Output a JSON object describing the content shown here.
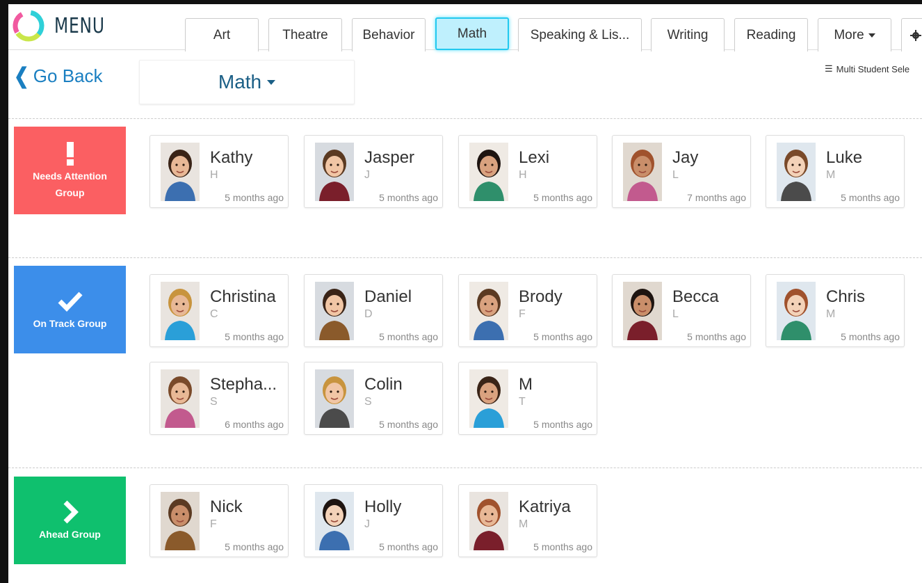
{
  "brand": {
    "menu_label": "MENU"
  },
  "tabs": [
    {
      "label": "Art",
      "active": false
    },
    {
      "label": "Theatre",
      "active": false
    },
    {
      "label": "Behavior",
      "active": false
    },
    {
      "label": "Math",
      "active": true
    },
    {
      "label": "Speaking & Lis...",
      "active": false
    },
    {
      "label": "Writing",
      "active": false
    },
    {
      "label": "Reading",
      "active": false
    },
    {
      "label": "More",
      "active": false
    }
  ],
  "go_back_label": "Go Back",
  "subject_dropdown": {
    "value": "Math"
  },
  "multi_select_label": "Multi Student Sele",
  "groups": [
    {
      "label_line1": "Needs Attention",
      "label_line2": "Group",
      "color": "#fb5f62",
      "icon": "exclamation-icon",
      "students": [
        {
          "name": "Kathy",
          "initial": "H",
          "updated": "5 months ago"
        },
        {
          "name": "Jasper",
          "initial": "J",
          "updated": "5 months ago"
        },
        {
          "name": "Lexi",
          "initial": "H",
          "updated": "5 months ago"
        },
        {
          "name": "Jay",
          "initial": "L",
          "updated": "7 months ago"
        },
        {
          "name": "Luke",
          "initial": "M",
          "updated": "5 months ago"
        }
      ]
    },
    {
      "label_line1": "On Track Group",
      "label_line2": "",
      "color": "#3c8eea",
      "icon": "checkmark-icon",
      "students": [
        {
          "name": "Christina",
          "initial": "C",
          "updated": "5 months ago"
        },
        {
          "name": "Daniel",
          "initial": "D",
          "updated": "5 months ago"
        },
        {
          "name": "Brody",
          "initial": "F",
          "updated": "5 months ago"
        },
        {
          "name": "Becca",
          "initial": "L",
          "updated": "5 months ago"
        },
        {
          "name": "Chris",
          "initial": "M",
          "updated": "5 months ago"
        },
        {
          "name": "Stepha...",
          "initial": "S",
          "updated": "6 months ago"
        },
        {
          "name": "Colin",
          "initial": "S",
          "updated": "5 months ago"
        },
        {
          "name": "M",
          "initial": "T",
          "updated": "5 months ago"
        }
      ]
    },
    {
      "label_line1": "Ahead Group",
      "label_line2": "",
      "color": "#0fc06e",
      "icon": "chevron-right-icon",
      "students": [
        {
          "name": "Nick",
          "initial": "F",
          "updated": "5 months ago"
        },
        {
          "name": "Holly",
          "initial": "J",
          "updated": "5 months ago"
        },
        {
          "name": "Katriya",
          "initial": "M",
          "updated": "5 months ago"
        }
      ]
    }
  ],
  "colors": {
    "accent": "#22c9ef",
    "link": "#1a7fc1",
    "needs_attention": "#fb5f62",
    "on_track": "#3c8eea",
    "ahead": "#0fc06e"
  }
}
